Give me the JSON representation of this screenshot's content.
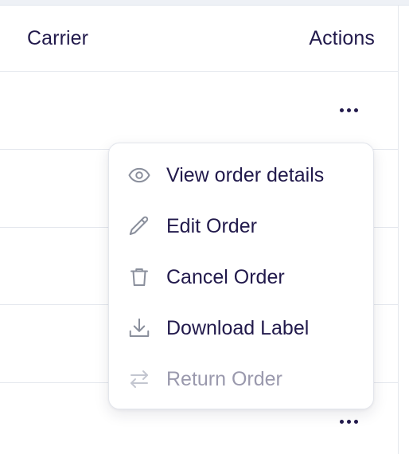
{
  "table": {
    "headers": {
      "carrier": "Carrier",
      "actions": "Actions"
    }
  },
  "menu": {
    "items": [
      {
        "label": "View order details",
        "icon": "eye-icon",
        "disabled": false
      },
      {
        "label": "Edit Order",
        "icon": "pencil-icon",
        "disabled": false
      },
      {
        "label": "Cancel Order",
        "icon": "trash-icon",
        "disabled": false
      },
      {
        "label": "Download Label",
        "icon": "download-icon",
        "disabled": false
      },
      {
        "label": "Return Order",
        "icon": "arrows-swap-icon",
        "disabled": true
      }
    ]
  },
  "colors": {
    "text_primary": "#221a4c",
    "text_disabled": "#9a99ad",
    "icon": "#8a8f9c",
    "border": "#e4e7ed"
  }
}
